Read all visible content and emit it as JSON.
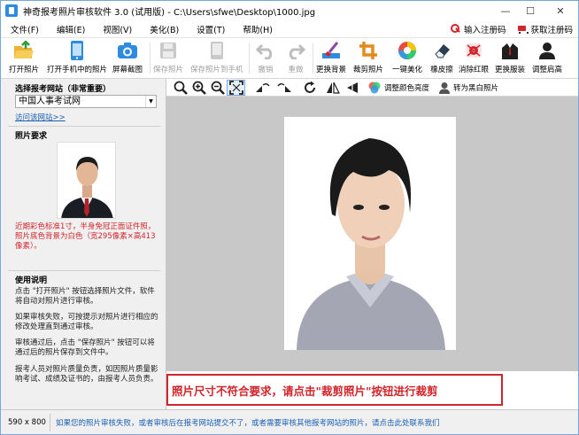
{
  "window": {
    "title": "神奇报考照片审核软件 3.0 (试用版) - C:\\Users\\sfwe\\Desktop\\1000.jpg",
    "minimize": "—",
    "maximize": "☐",
    "close": "✕"
  },
  "menu": {
    "items": [
      "文件(F)",
      "编辑(E)",
      "视图(V)",
      "美化(B)",
      "设置(T)",
      "帮助(H)"
    ],
    "register": "输入注册码",
    "buy": "获取注册码"
  },
  "toolbar": {
    "open_photo": "打开照片",
    "open_phone": "打开手机中的照片",
    "screenshot": "屏幕截图",
    "save_photo": "保存照片",
    "save_to_phone": "保存照片到手机",
    "undo": "撤销",
    "redo": "重做",
    "change_bg": "更换背景",
    "crop": "裁剪照片",
    "beautify": "一键美化",
    "eraser": "橡皮擦",
    "red_eye": "消除红眼",
    "change_clothes": "更换服装",
    "adjust_shoulder": "调整肩高"
  },
  "toolbar2": {
    "adjust_color": "调整颜色亮度",
    "to_bw": "转为黑白照片"
  },
  "sidebar": {
    "site_title": "选择报考网站（非常重要）",
    "site_value": "中国人事考试网",
    "visit_link": "访问该网站>>",
    "req_title": "照片要求",
    "req_text": "近期彩色标准1寸，半身免冠正面证件照，照片底色背景为白色（宽295像素×高413像素）。",
    "usage_title": "使用说明",
    "usage_1": "点击 \"打开照片\" 按钮选择照片文件，软件将自动对照片进行审核。",
    "usage_2": "如果审核失败，可按提示对照片进行相应的修改处理直到通过审核。",
    "usage_3": "审核通过后，点击 \"保存照片\" 按钮可以将通过后的照片保存到文件中。",
    "usage_4": "报考人员对照片质量负责，如因照片质量影响考试、成绩及证书的，由报考人员负责。"
  },
  "message": "照片尺寸不符合要求，请点击\"裁剪照片\"按钮进行裁剪",
  "status": {
    "size": "590 x 800",
    "link": "如果您的照片审核失败，或者审核后在报考网站提交不了，或者需要审核其他报考网站的照片，请点击此处联系我们"
  },
  "colors": {
    "accent_red": "#d0262b",
    "link_blue": "#1a5fb4",
    "canvas_gray": "#c8c8c8"
  },
  "icons": [
    "folder-open-icon",
    "phone-icon",
    "camera-icon",
    "save-icon",
    "save-to-phone-icon",
    "undo-icon",
    "redo-icon",
    "brush-icon",
    "crop-icon",
    "color-wheel-icon",
    "eraser-icon",
    "red-eye-icon",
    "suit-icon",
    "shoulder-icon",
    "zoom-fit-icon",
    "zoom-in-icon",
    "zoom-out-icon",
    "fullscreen-icon",
    "rotate-left-icon",
    "rotate-right-icon",
    "refresh-icon",
    "flip-horizontal-icon",
    "flip-vertical-icon",
    "color-adjust-icon",
    "person-icon",
    "key-icon",
    "cart-icon"
  ]
}
